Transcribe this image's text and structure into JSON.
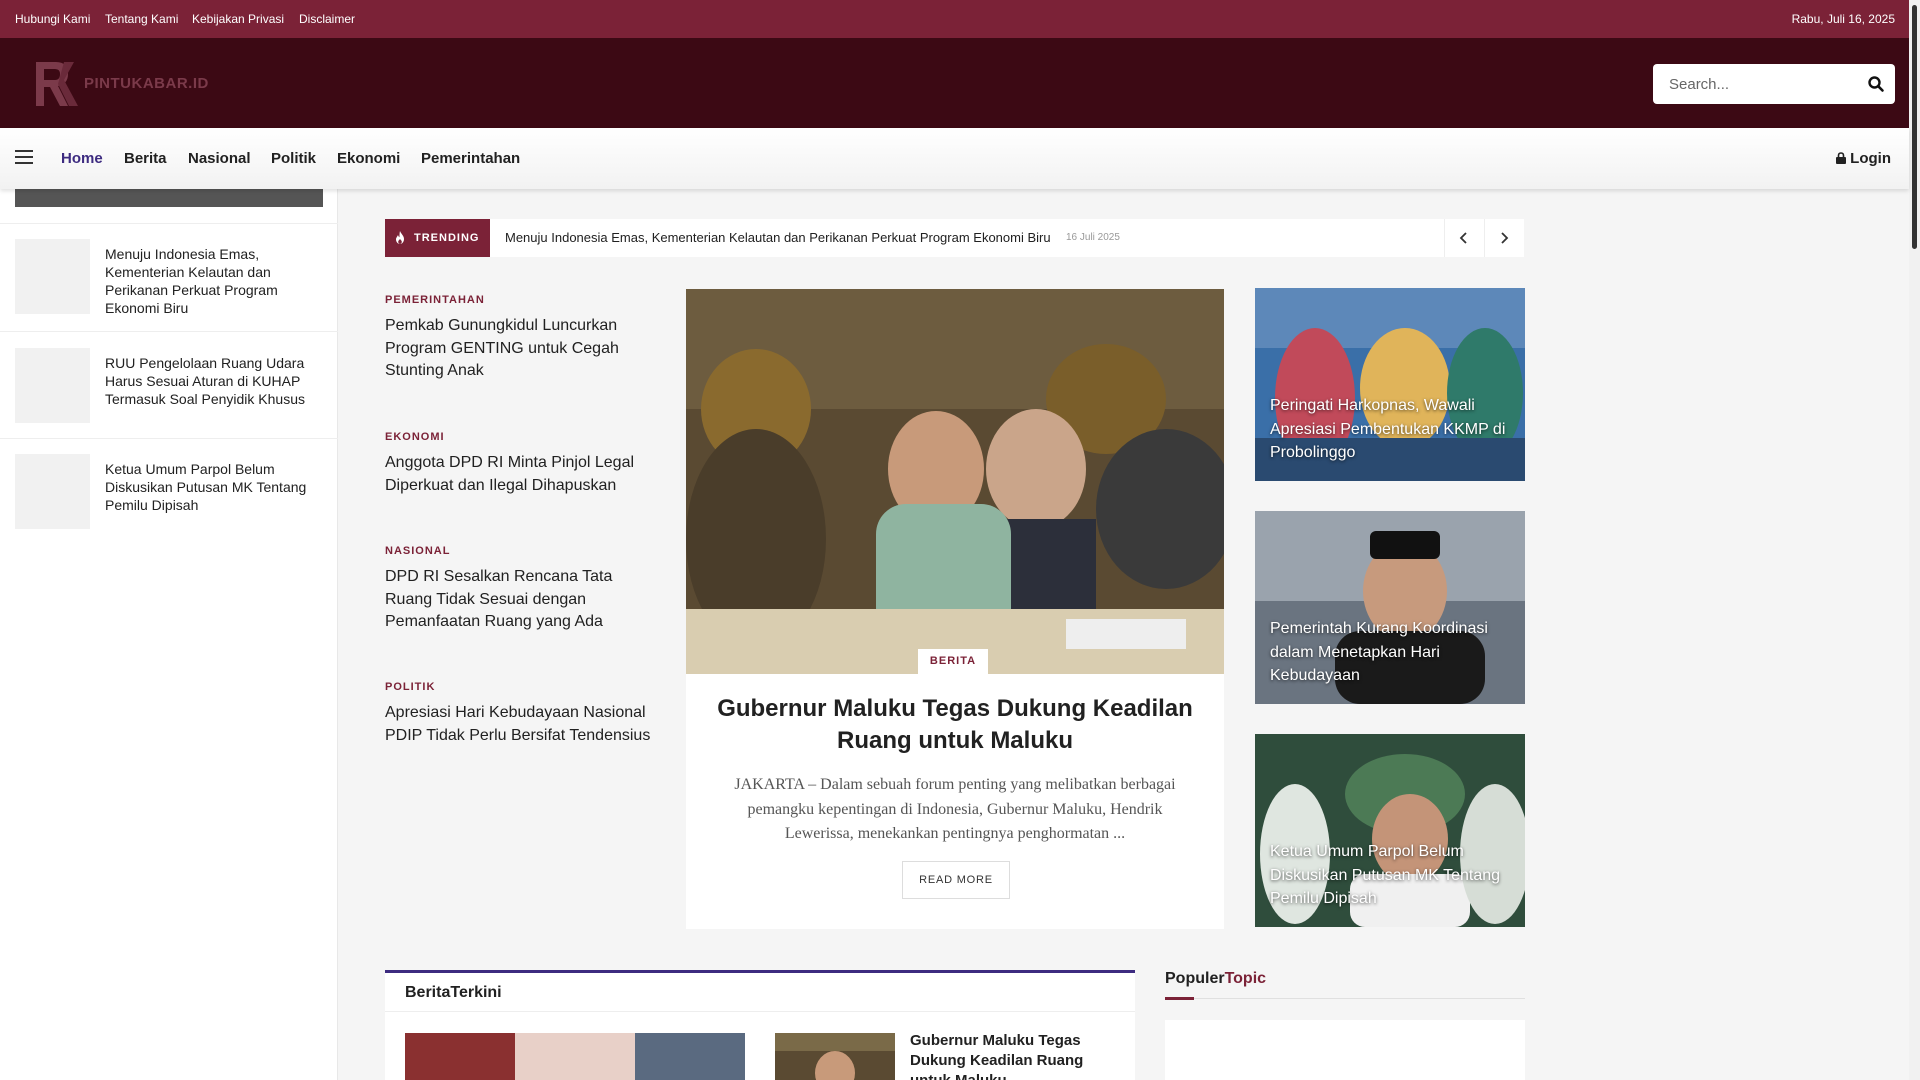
{
  "topbar": {
    "links": [
      "Hubungi Kami",
      "Tentang Kami",
      "Kebijakan Privasi",
      "Disclaimer"
    ],
    "date": "Rabu, Juli 16, 2025"
  },
  "header": {
    "logo_text": "PINTUKABAR.ID",
    "search_placeholder": "Search..."
  },
  "nav": {
    "items": [
      "Home",
      "Berita",
      "Nasional",
      "Politik",
      "Ekonomi",
      "Pemerintahan"
    ],
    "login": "Login"
  },
  "sidebar": {
    "items": [
      "Menuju Indonesia Emas, Kementerian Kelautan dan Perikanan Perkuat Program Ekonomi Biru",
      "RUU Pengelolaan Ruang Udara Harus Sesuai Aturan di KUHAP Termasuk Soal Penyidik Khusus",
      "Ketua Umum Parpol Belum Diskusikan Putusan MK Tentang Pemilu Dipisah"
    ]
  },
  "trending": {
    "label": "TRENDING",
    "title": "Menuju Indonesia Emas, Kementerian Kelautan dan Perikanan Perkuat Program Ekonomi Biru",
    "date": "16 Juli 2025"
  },
  "left_column": [
    {
      "category": "PEMERINTAHAN",
      "title": "Pemkab Gunungkidul Luncurkan Program GENTING untuk Cegah Stunting Anak"
    },
    {
      "category": "EKONOMI",
      "title": "Anggota DPD RI Minta Pinjol Legal Diperkuat dan Ilegal Dihapuskan"
    },
    {
      "category": "NASIONAL",
      "title": "DPD RI Sesalkan Rencana Tata Ruang Tidak Sesuai dengan Pemanfaatan Ruang yang Ada"
    },
    {
      "category": "POLITIK",
      "title": "Apresiasi Hari Kebudayaan Nasional PDIP Tidak Perlu Bersifat Tendensius"
    }
  ],
  "featured": {
    "category": "BERITA",
    "title": "Gubernur Maluku Tegas Dukung Keadilan Ruang untuk Maluku",
    "excerpt": "JAKARTA – Dalam sebuah forum penting yang melibatkan berbagai pemangku kepentingan di Indonesia, Gubernur Maluku, Hendrik Lewerissa, menekankan pentingnya penghormatan ...",
    "read_more": "READ MORE"
  },
  "right_cards": [
    {
      "title": "Peringati Harkopnas, Wawali Apresiasi Pembentukan KKMP di Probolinggo"
    },
    {
      "title": "Pemerintah Kurang Koordinasi dalam Menetapkan Hari Kebudayaan"
    },
    {
      "title": "Ketua Umum Parpol Belum Diskusikan Putusan MK Tentang Pemilu Dipisah"
    }
  ],
  "berita_terkini": {
    "heading": "BeritaTerkini",
    "item_title": "Gubernur Maluku Tegas Dukung Keadilan Ruang untuk Maluku"
  },
  "populer": {
    "heading_a": "Populer",
    "heading_b": "Topic"
  },
  "colors": {
    "brand": "#7b2237",
    "header_dark": "#3c0914",
    "nav_active": "#3d2b80"
  },
  "icons": [
    "menu-icon",
    "search-icon",
    "lock-icon",
    "fire-icon",
    "chevron-left-icon",
    "chevron-right-icon"
  ]
}
